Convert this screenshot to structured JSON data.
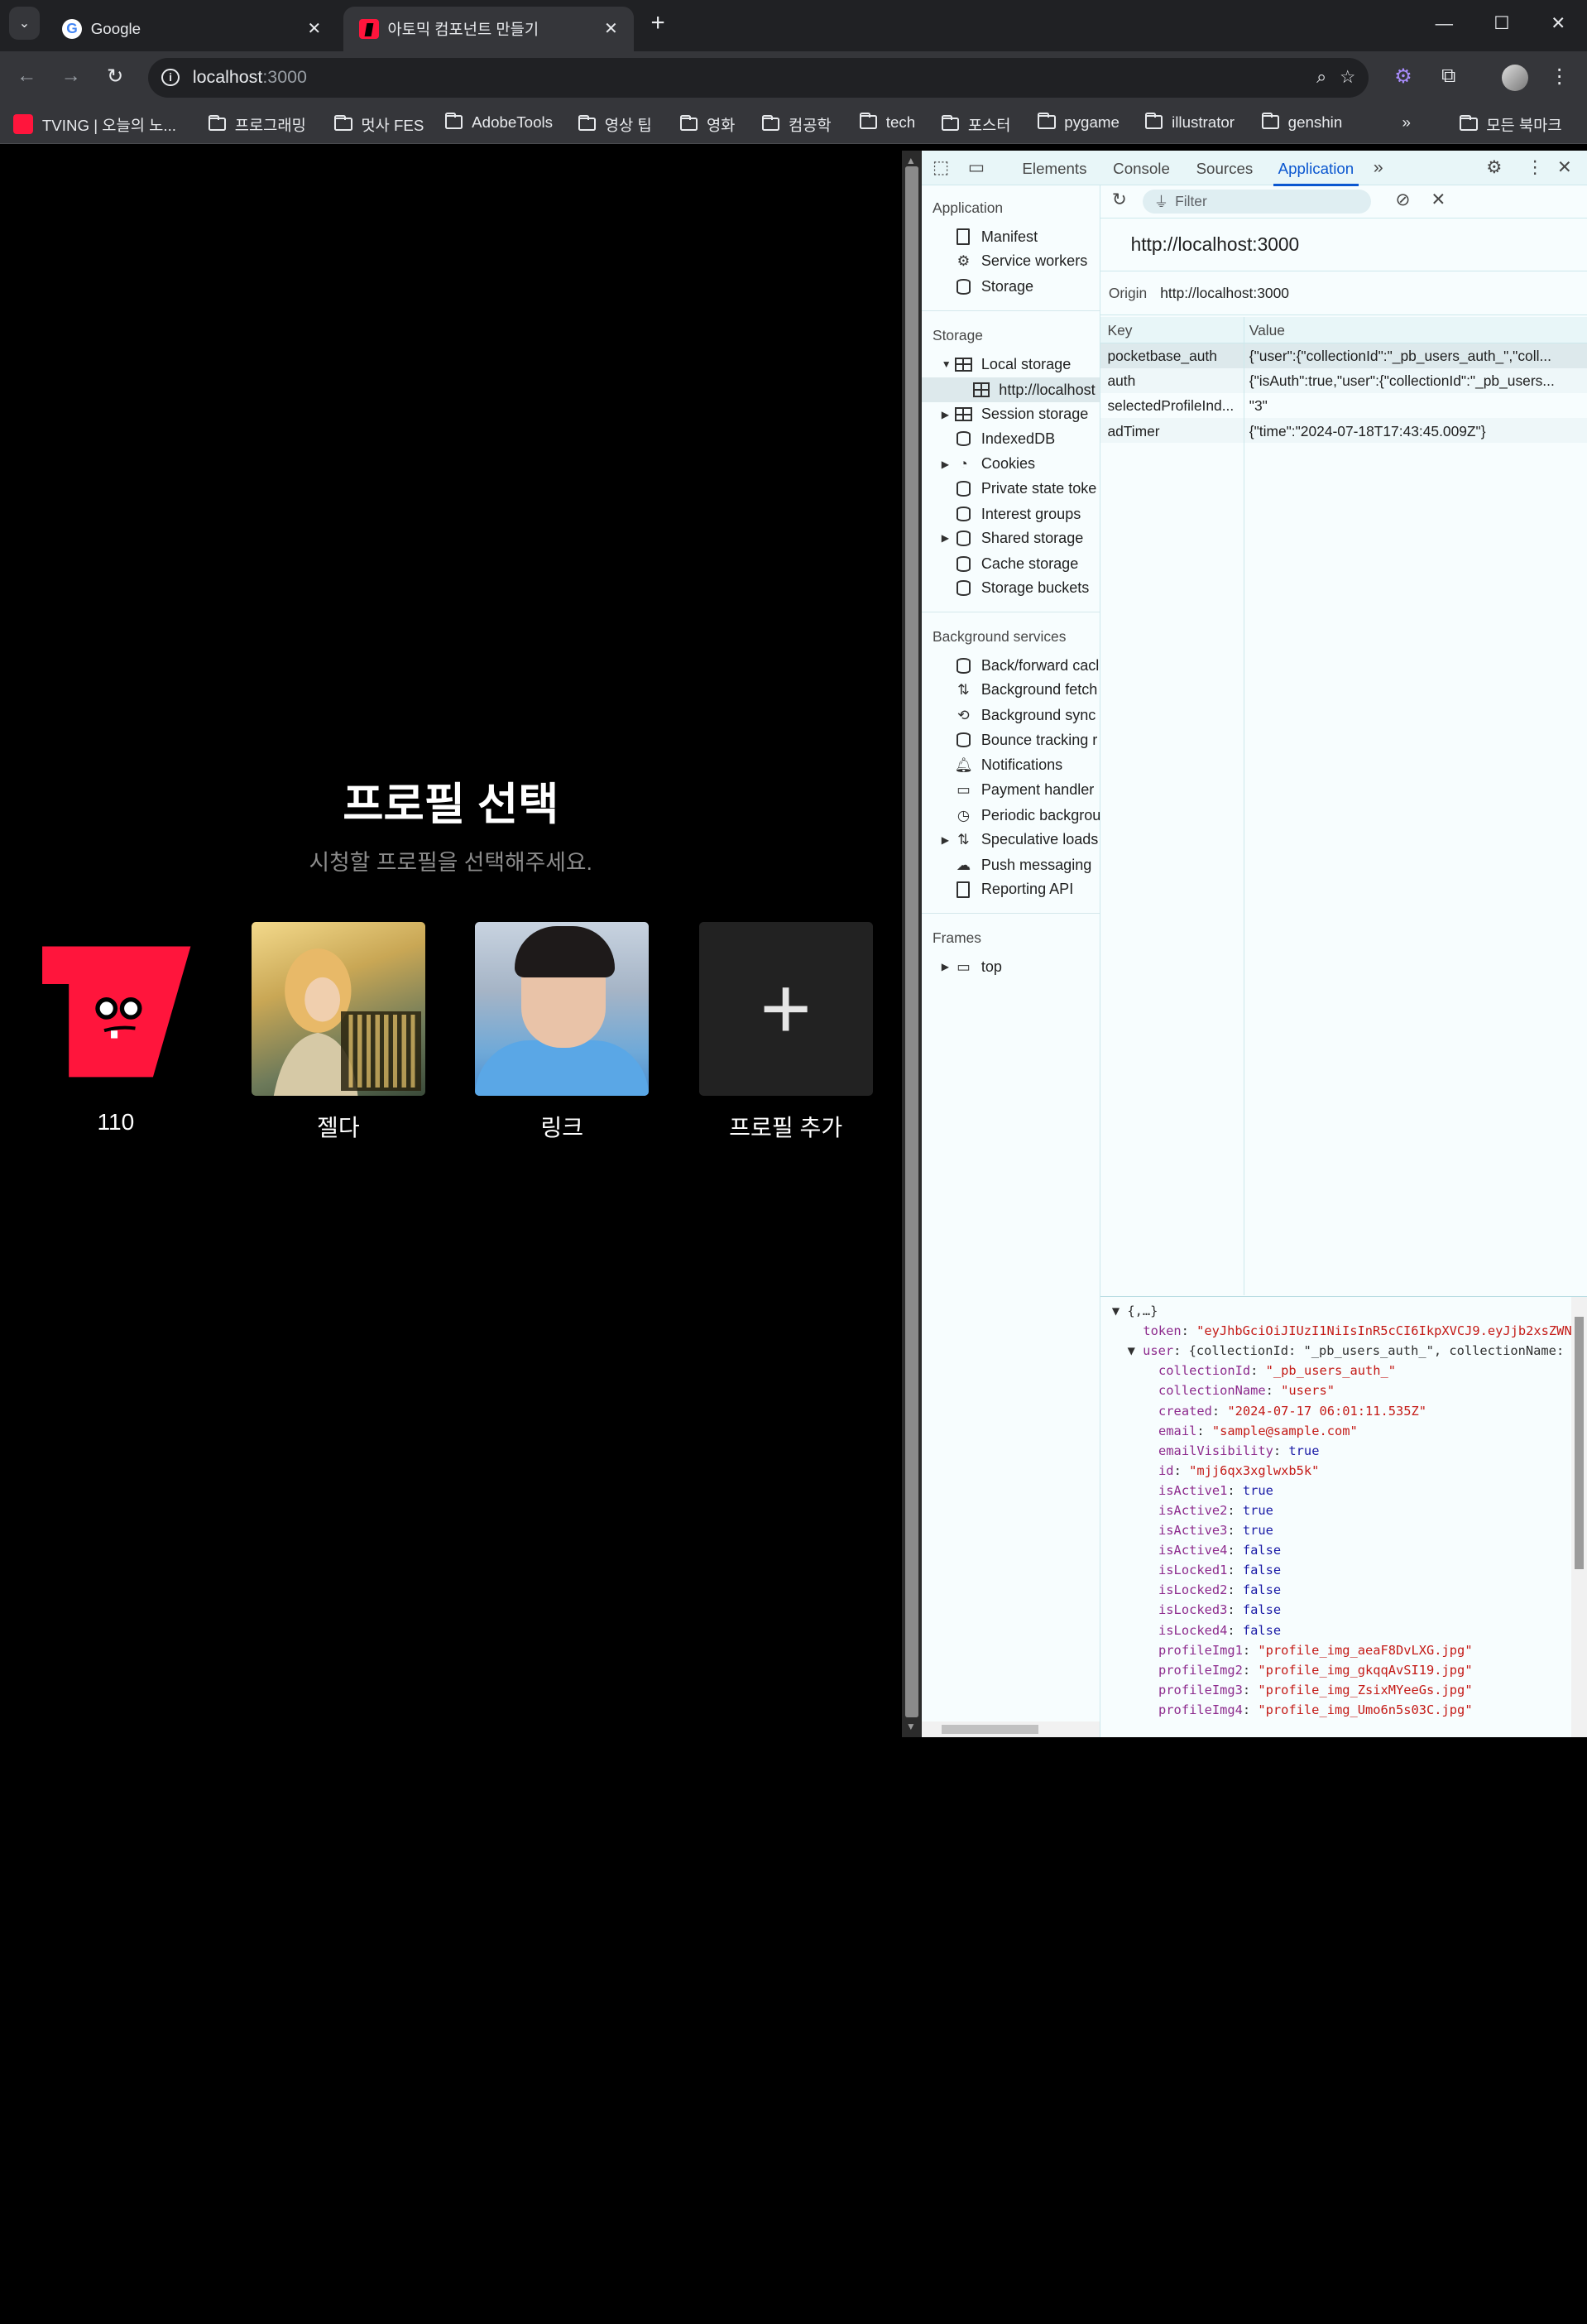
{
  "browser": {
    "tabs": [
      {
        "title": "Google",
        "icon": "google-icon",
        "active": false
      },
      {
        "title": "아토믹 컴포넌트 만들기",
        "icon": "tving-icon",
        "active": true
      }
    ],
    "url": {
      "host": "localhost",
      "port": ":3000"
    },
    "bookmarks": [
      "TVING | 오늘의 노...",
      "프로그래밍",
      "멋사 FES",
      "AdobeTools",
      "영상 팁",
      "영화",
      "컴공학",
      "tech",
      "포스터",
      "pygame",
      "illustrator",
      "genshin"
    ],
    "all_bookmarks": "모든 북마크",
    "more_bookmarks": "»"
  },
  "page": {
    "title": "프로필 선택",
    "subtitle": "시청할 프로필을 선택해주세요.",
    "profiles": [
      {
        "name": "110",
        "avatar": "red-character"
      },
      {
        "name": "젤다",
        "avatar": "zelda-photo"
      },
      {
        "name": "링크",
        "avatar": "link-photo"
      },
      {
        "name": "프로필 추가",
        "avatar": "plus-icon"
      }
    ]
  },
  "devtools": {
    "tabs": [
      "Elements",
      "Console",
      "Sources",
      "Application"
    ],
    "selected_tab": "Application",
    "sidebar": {
      "application_header": "Application",
      "application_items": [
        "Manifest",
        "Service workers",
        "Storage"
      ],
      "storage_header": "Storage",
      "storage_items": [
        "Local storage",
        "http://localhost",
        "Session storage",
        "IndexedDB",
        "Cookies",
        "Private state toke",
        "Interest groups",
        "Shared storage",
        "Cache storage",
        "Storage buckets"
      ],
      "background_header": "Background services",
      "background_items": [
        "Back/forward cacl",
        "Background fetch",
        "Background sync",
        "Bounce tracking r",
        "Notifications",
        "Payment handler",
        "Periodic backgrou",
        "Speculative loads",
        "Push messaging",
        "Reporting API"
      ],
      "frames_header": "Frames",
      "frames_items": [
        "top"
      ]
    },
    "filter_placeholder": "Filter",
    "origin_title": "http://localhost:3000",
    "origin_label": "Origin",
    "origin_value": "http://localhost:3000",
    "table": {
      "headers": [
        "Key",
        "Value"
      ],
      "rows": [
        {
          "key": "pocketbase_auth",
          "value": "{\"user\":{\"collectionId\":\"_pb_users_auth_\",\"coll..."
        },
        {
          "key": "auth",
          "value": "{\"isAuth\":true,\"user\":{\"collectionId\":\"_pb_users..."
        },
        {
          "key": "selectedProfileInd...",
          "value": "\"3\""
        },
        {
          "key": "adTimer",
          "value": "{\"time\":\"2024-07-18T17:43:45.009Z\"}"
        }
      ]
    },
    "preview": {
      "root": "{,…}",
      "token_key": "token",
      "token_value": "\"eyJhbGciOiJIUzI1NiIsInR5cCI6IkpXVCJ9.eyJjb2xsZWNC",
      "user_key": "user",
      "user_summary": "{collectionId: \"_pb_users_auth_\", collectionName: \"",
      "fields": [
        {
          "k": "collectionId",
          "v": "\"_pb_users_auth_\"",
          "t": "s"
        },
        {
          "k": "collectionName",
          "v": "\"users\"",
          "t": "s"
        },
        {
          "k": "created",
          "v": "\"2024-07-17 06:01:11.535Z\"",
          "t": "s"
        },
        {
          "k": "email",
          "v": "\"sample@sample.com\"",
          "t": "s"
        },
        {
          "k": "emailVisibility",
          "v": "true",
          "t": "b"
        },
        {
          "k": "id",
          "v": "\"mjj6qx3xglwxb5k\"",
          "t": "s"
        },
        {
          "k": "isActive1",
          "v": "true",
          "t": "b"
        },
        {
          "k": "isActive2",
          "v": "true",
          "t": "b"
        },
        {
          "k": "isActive3",
          "v": "true",
          "t": "b"
        },
        {
          "k": "isActive4",
          "v": "false",
          "t": "b"
        },
        {
          "k": "isLocked1",
          "v": "false",
          "t": "b"
        },
        {
          "k": "isLocked2",
          "v": "false",
          "t": "b"
        },
        {
          "k": "isLocked3",
          "v": "false",
          "t": "b"
        },
        {
          "k": "isLocked4",
          "v": "false",
          "t": "b"
        },
        {
          "k": "profileImg1",
          "v": "\"profile_img_aeaF8DvLXG.jpg\"",
          "t": "s"
        },
        {
          "k": "profileImg2",
          "v": "\"profile_img_gkqqAvSI19.jpg\"",
          "t": "s"
        },
        {
          "k": "profileImg3",
          "v": "\"profile_img_ZsixMYeeGs.jpg\"",
          "t": "s"
        },
        {
          "k": "profileImg4",
          "v": "\"profile_img_Umo6n5s03C.jpg\"",
          "t": "s"
        }
      ]
    }
  },
  "colors": {
    "accent": "#0b57d0",
    "brand_red": "#ff153c"
  }
}
